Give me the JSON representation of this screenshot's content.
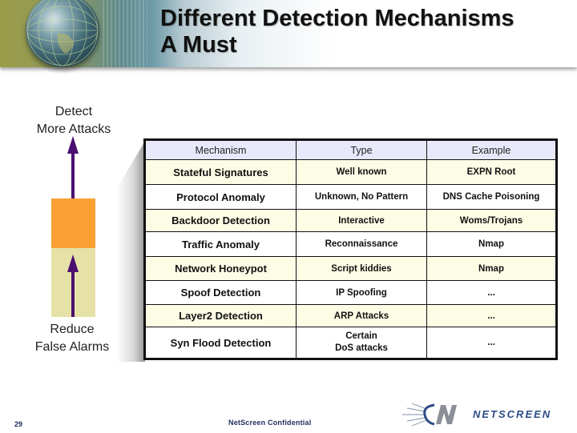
{
  "slide": {
    "title": "Different Detection Mechanisms\nA Must",
    "left_axis": {
      "top_label": "Detect\nMore Attacks",
      "bottom_label": "Reduce\nFalse Alarms"
    },
    "colors": {
      "arrow": "#4b0f72",
      "orange_block": "#fba134",
      "tan_block": "#e6e1a6",
      "header_row": "#e8e8fb",
      "odd_row": "#fdfde6",
      "footer_text": "#1c2c5c"
    },
    "table": {
      "headers": [
        "Mechanism",
        "Type",
        "Example"
      ],
      "rows": [
        {
          "mechanism": "Stateful Signatures",
          "type": "Well known",
          "example": "EXPN Root"
        },
        {
          "mechanism": "Protocol Anomaly",
          "type": "Unknown, No Pattern",
          "example": "DNS Cache Poisoning"
        },
        {
          "mechanism": "Backdoor Detection",
          "type": "Interactive",
          "example": "Woms/Trojans"
        },
        {
          "mechanism": "Traffic Anomaly",
          "type": "Reconnaissance",
          "example": "Nmap"
        },
        {
          "mechanism": "Network Honeypot",
          "type": "Script kiddies",
          "example": "Nmap"
        },
        {
          "mechanism": "Spoof Detection",
          "type": "IP Spoofing",
          "example": "..."
        },
        {
          "mechanism": "Layer2 Detection",
          "type": "ARP Attacks",
          "example": "..."
        },
        {
          "mechanism": "Syn Flood Detection",
          "type": "Certain\nDoS attacks",
          "example": "..."
        }
      ]
    },
    "footer": {
      "page_number": "29",
      "confidential": "NetScreen Confidential",
      "logo_text": "NETSCREEN",
      "logo_icon": "netscreen-logo-icon"
    },
    "header_image": "globe-banner-image"
  }
}
